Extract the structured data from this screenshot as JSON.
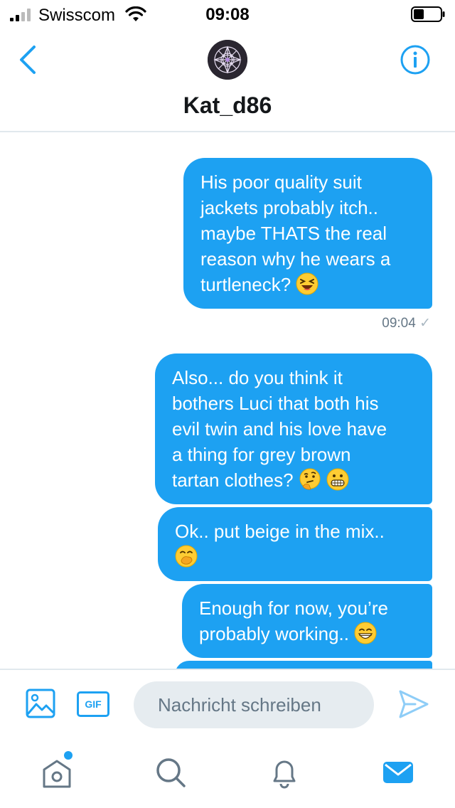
{
  "status_bar": {
    "carrier": "Swisscom",
    "time": "09:08"
  },
  "header": {
    "username": "Kat_d86"
  },
  "messages": [
    {
      "lines": [
        "His poor quality suit",
        "jackets probably itch..",
        "maybe THATS the real",
        "reason why he wears a",
        "turtleneck?"
      ],
      "emoji": [
        "laughing-squint"
      ]
    },
    {
      "lines": [
        "Also... do you think it",
        "bothers Luci that both his",
        "evil twin and his love have",
        "a thing for grey brown",
        "tartan clothes?"
      ],
      "emoji": [
        "thinking",
        "grimacing"
      ]
    },
    {
      "lines": [
        "Ok.. put beige in the mix.."
      ],
      "emoji": [
        "hand-over-mouth"
      ]
    },
    {
      "lines": [
        "Enough for now, you’re",
        "probably working.."
      ],
      "emoji": [
        "grinning"
      ]
    }
  ],
  "message_meta": {
    "time": "09:04",
    "check": "✓"
  },
  "composer": {
    "gif_label": "GIF",
    "placeholder": "Nachricht schreiben"
  },
  "tabbar": {
    "items": [
      "home-icon",
      "search-icon",
      "bell-icon",
      "mail-icon"
    ],
    "unread_dot": true
  },
  "colors": {
    "accent": "#1da1f2",
    "input_bg": "#e6ecf0",
    "meta_text": "#657786",
    "divider": "#e1e8ed"
  }
}
